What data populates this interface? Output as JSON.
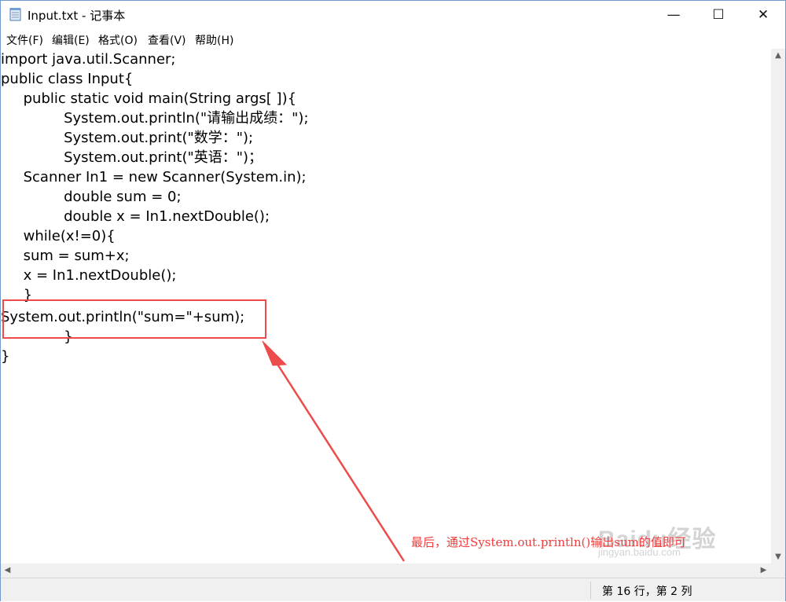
{
  "window": {
    "title": "Input.txt - 记事本",
    "controls": {
      "minimize": "—",
      "maximize": "☐",
      "close": "✕"
    }
  },
  "menu": [
    "文件(F)",
    "编辑(E)",
    "格式(O)",
    "查看(V)",
    "帮助(H)"
  ],
  "code_lines": [
    "import java.util.Scanner;",
    "public class Input{",
    "     public static void main(String args[ ]){",
    "              System.out.println(\"请输出成绩：\");",
    "              System.out.print(\"数学：\");",
    "              System.out.print(\"英语：\")；",
    "     Scanner In1 = new Scanner(System.in);",
    "              double sum = 0;",
    "              double x = In1.nextDouble();",
    "     while(x!=0){",
    "     sum = sum+x;",
    "     x = In1.nextDouble();",
    "     }",
    "System.out.println(\"sum=\"+sum);",
    "              }",
    "}"
  ],
  "annotation": {
    "text": "最后，通过System.out.println()输出sum的值即可",
    "color": "#f23b3b"
  },
  "watermark": {
    "main": "Baidu经验",
    "sub": "jingyan.baidu.com"
  },
  "scrollbars": {
    "up": "▲",
    "down": "▼",
    "left": "◀",
    "right": "▶"
  },
  "status": {
    "position": "第 16 行，第 2 列"
  }
}
